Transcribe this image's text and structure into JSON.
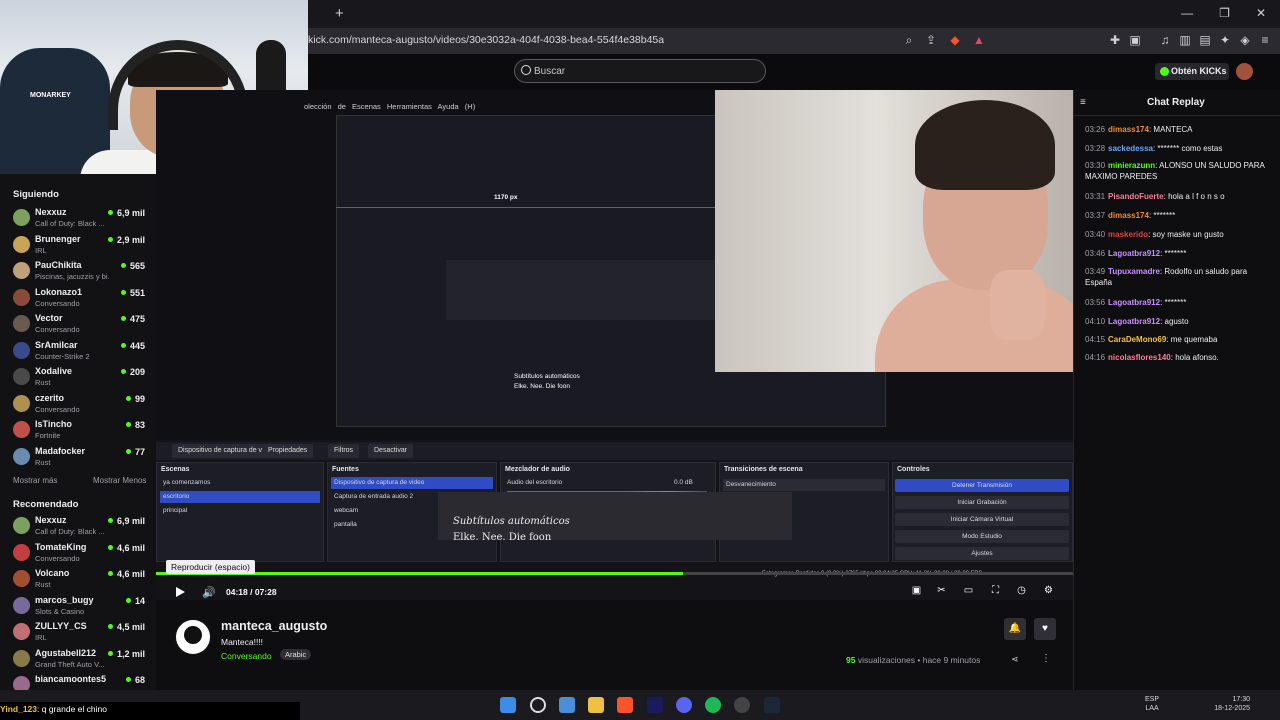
{
  "browser": {
    "url": "kick.com/manteca-augusto/videos/30e3032a-404f-4038-bea4-554f4e38b45a",
    "new_tab": "+",
    "window_controls": [
      "—",
      "❐",
      "✕"
    ]
  },
  "header": {
    "search_placeholder": "Buscar",
    "kicks_label": "Obtén KICKs"
  },
  "sidebar": {
    "following_title": "Siguiendo",
    "following": [
      {
        "name": "Nexxuz",
        "category": "Call of Duty: Black ...",
        "viewers": "6,9 mil",
        "color": "#7aa25e"
      },
      {
        "name": "Brunenger",
        "category": "IRL",
        "viewers": "2,9 mil",
        "color": "#c8a35a"
      },
      {
        "name": "PauChikita",
        "category": "Piscinas, jacuzzis y bi...",
        "viewers": "565",
        "color": "#c0a07a"
      },
      {
        "name": "Lokonazo1",
        "category": "Conversando",
        "viewers": "551",
        "color": "#8a4a3a"
      },
      {
        "name": "Vector",
        "category": "Conversando",
        "viewers": "475",
        "color": "#6a5a50"
      },
      {
        "name": "SrAmilcar",
        "category": "Counter-Strike 2",
        "viewers": "445",
        "color": "#3a4a8a"
      },
      {
        "name": "Xodalive",
        "category": "Rust",
        "viewers": "209",
        "color": "#4a4a4a"
      },
      {
        "name": "czerito",
        "category": "Conversando",
        "viewers": "99",
        "color": "#b09050"
      },
      {
        "name": "IsTincho",
        "category": "Fortnite",
        "viewers": "83",
        "color": "#c0504a"
      },
      {
        "name": "Madafocker",
        "category": "Rust",
        "viewers": "77",
        "color": "#6a8ab0"
      }
    ],
    "show_more": "Mostrar más",
    "show_less": "Mostrar Menos",
    "recommended_title": "Recomendado",
    "recommended": [
      {
        "name": "Nexxuz",
        "category": "Call of Duty: Black ...",
        "viewers": "6,9 mil",
        "color": "#7aa25e"
      },
      {
        "name": "TomateKing",
        "category": "Conversando",
        "viewers": "4,6 mil",
        "color": "#c04040"
      },
      {
        "name": "Volcano",
        "category": "Rust",
        "viewers": "4,6 mil",
        "color": "#a05030"
      },
      {
        "name": "marcos_bugy",
        "category": "Slots & Casino",
        "viewers": "14",
        "color": "#7a6a9a"
      },
      {
        "name": "ZULLYY_CS",
        "category": "IRL",
        "viewers": "4,5 mil",
        "color": "#c07070"
      },
      {
        "name": "Agustabell212",
        "category": "Grand Theft Auto V...",
        "viewers": "1,2 mil",
        "color": "#8a7a4a"
      },
      {
        "name": "biancamoontes5",
        "category": "",
        "viewers": "68",
        "color": "#9a6a8a"
      }
    ]
  },
  "video": {
    "obs_menu": "olección de Escenas   Herramientas   Ayuda (H)",
    "measure_label": "1170 px",
    "subs_small_1": "Subtítulos automáticos",
    "subs_small_2": "Elke. Nee. Die foon",
    "source_bar_label": "Dispositivo de captura de v",
    "source_bar_props": "Propiedades",
    "source_bar_filters": "Filtros",
    "source_bar_deactivate": "Desactivar",
    "panels": {
      "scenes_title": "Escenas",
      "scenes": [
        "ya comenzamos",
        "escritorio",
        "principal"
      ],
      "sources_title": "Fuentes",
      "sources": [
        "Dispositivo de captura de video",
        "Captura de entrada audio 2",
        "webcam",
        "pantalla"
      ],
      "mixer_title": "Mezclador de audio",
      "mixer_item": "Audio del escritorio",
      "mixer_db": "0.0 dB",
      "transitions_title": "Transiciones de escena",
      "transition": "Desvanecimiento",
      "controls_title": "Controles",
      "controls": [
        "Detener Transmisión",
        "Iniciar Grabación",
        "Iniciar Cámara Virtual",
        "Modo Estudio",
        "Ajustes"
      ]
    },
    "subs_big_1": "Subtítulos automáticos",
    "subs_big_2": "Elke. Nee. Die foon",
    "status_bar": "Fotogramas Perdidos 0 (0.0%)     2765 kbps     00:04:25     CPU: 11.3%   30.00 / 30.00 FPS"
  },
  "player": {
    "tooltip": "Reproducir (espacio)",
    "current_time": "04:18",
    "duration": "07:28",
    "progress": 0.575
  },
  "stream": {
    "name": "manteca_augusto",
    "title": "Manteca!!!!",
    "category": "Conversando",
    "tag": "Arabic",
    "views_count": "95",
    "views_label": "visualizaciones",
    "time_ago": "hace 9 minutos"
  },
  "chat": {
    "title": "Chat Replay",
    "messages": [
      {
        "time": "03:26",
        "user": "dimass174",
        "text": "MANTECA",
        "color": "#f08a3a"
      },
      {
        "time": "03:28",
        "user": "sackedessa",
        "text": "******* como estas",
        "color": "#6aa8ff"
      },
      {
        "time": "03:30",
        "user": "minierazunn",
        "text": "ALONSO UN SALUDO PARA MAXIMO PAREDES",
        "color": "#53fc18"
      },
      {
        "time": "03:31",
        "user": "PisandoFuerte",
        "text": "hola a l f o n s o",
        "color": "#ff7a9a"
      },
      {
        "time": "03:37",
        "user": "dimass174",
        "text": "*******",
        "color": "#f08a3a"
      },
      {
        "time": "03:40",
        "user": "maskerido",
        "text": "soy maske un gusto",
        "color": "#e04040"
      },
      {
        "time": "03:46",
        "user": "Lagoatbra912",
        "text": "*******",
        "color": "#c890ff"
      },
      {
        "time": "03:49",
        "user": "Tupuxamadre",
        "text": "Rodolfo un saludo para España",
        "color": "#c890ff"
      },
      {
        "time": "03:56",
        "user": "Lagoatbra912",
        "text": "*******",
        "color": "#c890ff"
      },
      {
        "time": "04:10",
        "user": "Lagoatbra912",
        "text": "agusto",
        "color": "#c890ff"
      },
      {
        "time": "04:15",
        "user": "CaraDeMono69",
        "text": "me quemaba",
        "color": "#f0c040"
      },
      {
        "time": "04:16",
        "user": "nicolasflores140",
        "text": "hola afonso.",
        "color": "#ff7a9a"
      }
    ]
  },
  "overlay_chat": {
    "user": "Yind_123",
    "text": ": q grande el chino"
  },
  "taskbar": {
    "lang": "ESP",
    "lang2": "LAA",
    "time": "17:30",
    "date": "18-12-2025"
  }
}
